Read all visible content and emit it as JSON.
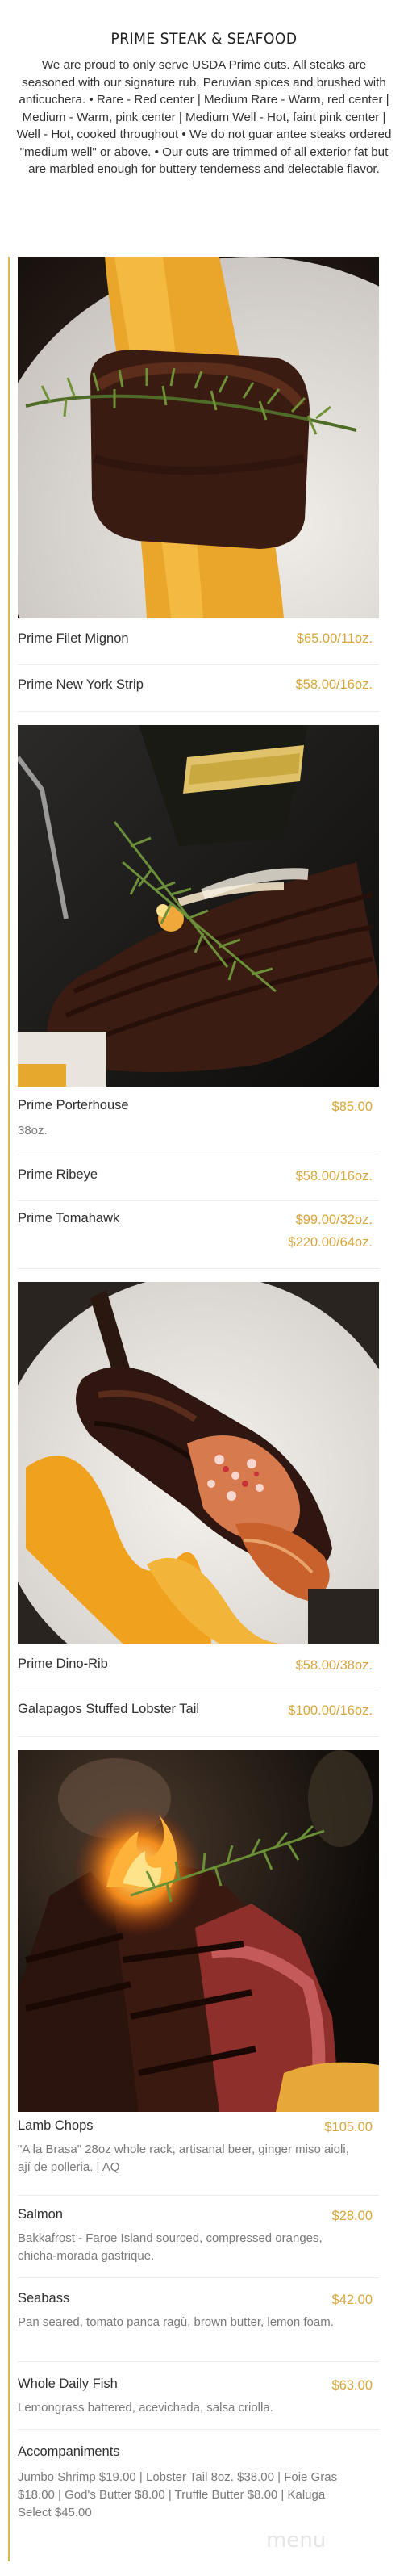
{
  "section": {
    "title": "PRIME STEAK & SEAFOOD",
    "intro": "We are proud to only serve USDA Prime cuts. All steaks are seasoned with our signature rub, Peruvian spices and brushed with anticuchera. • Rare - Red center | Medium Rare - Warm, red center | Medium - Warm, pink center | Medium Well - Hot, faint pink center | Well - Hot, cooked throughout • We do not guar antee steaks ordered \"medium well\" or above. • Our cuts are trimmed of all exterior fat but are marbled enough for buttery tenderness and delectable flavor."
  },
  "items": [
    {
      "name": "Prime Filet Mignon",
      "price": "$65.00/11oz."
    },
    {
      "name": "Prime New York Strip",
      "price": "$58.00/16oz."
    },
    {
      "name": "Prime Porterhouse",
      "price": "$85.00",
      "desc": "38oz."
    },
    {
      "name": "Prime Ribeye",
      "price": "$58.00/16oz."
    },
    {
      "name": "Prime Tomahawk",
      "price": "$99.00/32oz.",
      "price2": "$220.00/64oz."
    },
    {
      "name": "Prime Dino-Rib",
      "price": "$58.00/38oz."
    },
    {
      "name": "Galapagos Stuffed Lobster Tail",
      "price": "$100.00/16oz."
    },
    {
      "name": "Lamb Chops",
      "price": "$105.00",
      "desc": "\"A la Brasa\" 28oz whole rack, artisanal beer, ginger miso aioli, ají de polleria. | AQ"
    },
    {
      "name": "Salmon",
      "price": "$28.00",
      "desc": "Bakkafrost - Faroe Island sourced, compressed oranges, chicha-morada gastrique."
    },
    {
      "name": "Seabass",
      "price": "$42.00",
      "desc": "Pan seared, tomato panca ragù, brown butter, lemon foam."
    },
    {
      "name": "Whole Daily Fish",
      "price": "$63.00",
      "desc": "Lemongrass battered, acevichada, salsa criolla."
    },
    {
      "name": "Accompaniments",
      "price": "",
      "desc": "Jumbo Shrimp $19.00 | Lobster Tail 8oz. $38.00 | Foie Gras $18.00 | God's Butter $8.00 | Truffle Butter $8.00 | Kaluga Select $45.00"
    }
  ],
  "photos": [
    {
      "icon": "filet-mignon-photo"
    },
    {
      "icon": "porterhouse-photo"
    },
    {
      "icon": "dino-rib-photo"
    },
    {
      "icon": "lamb-chops-photo"
    }
  ],
  "watermark": "menu",
  "colors": {
    "accent": "#d7a63b",
    "divider_line": "#d8b74c"
  }
}
